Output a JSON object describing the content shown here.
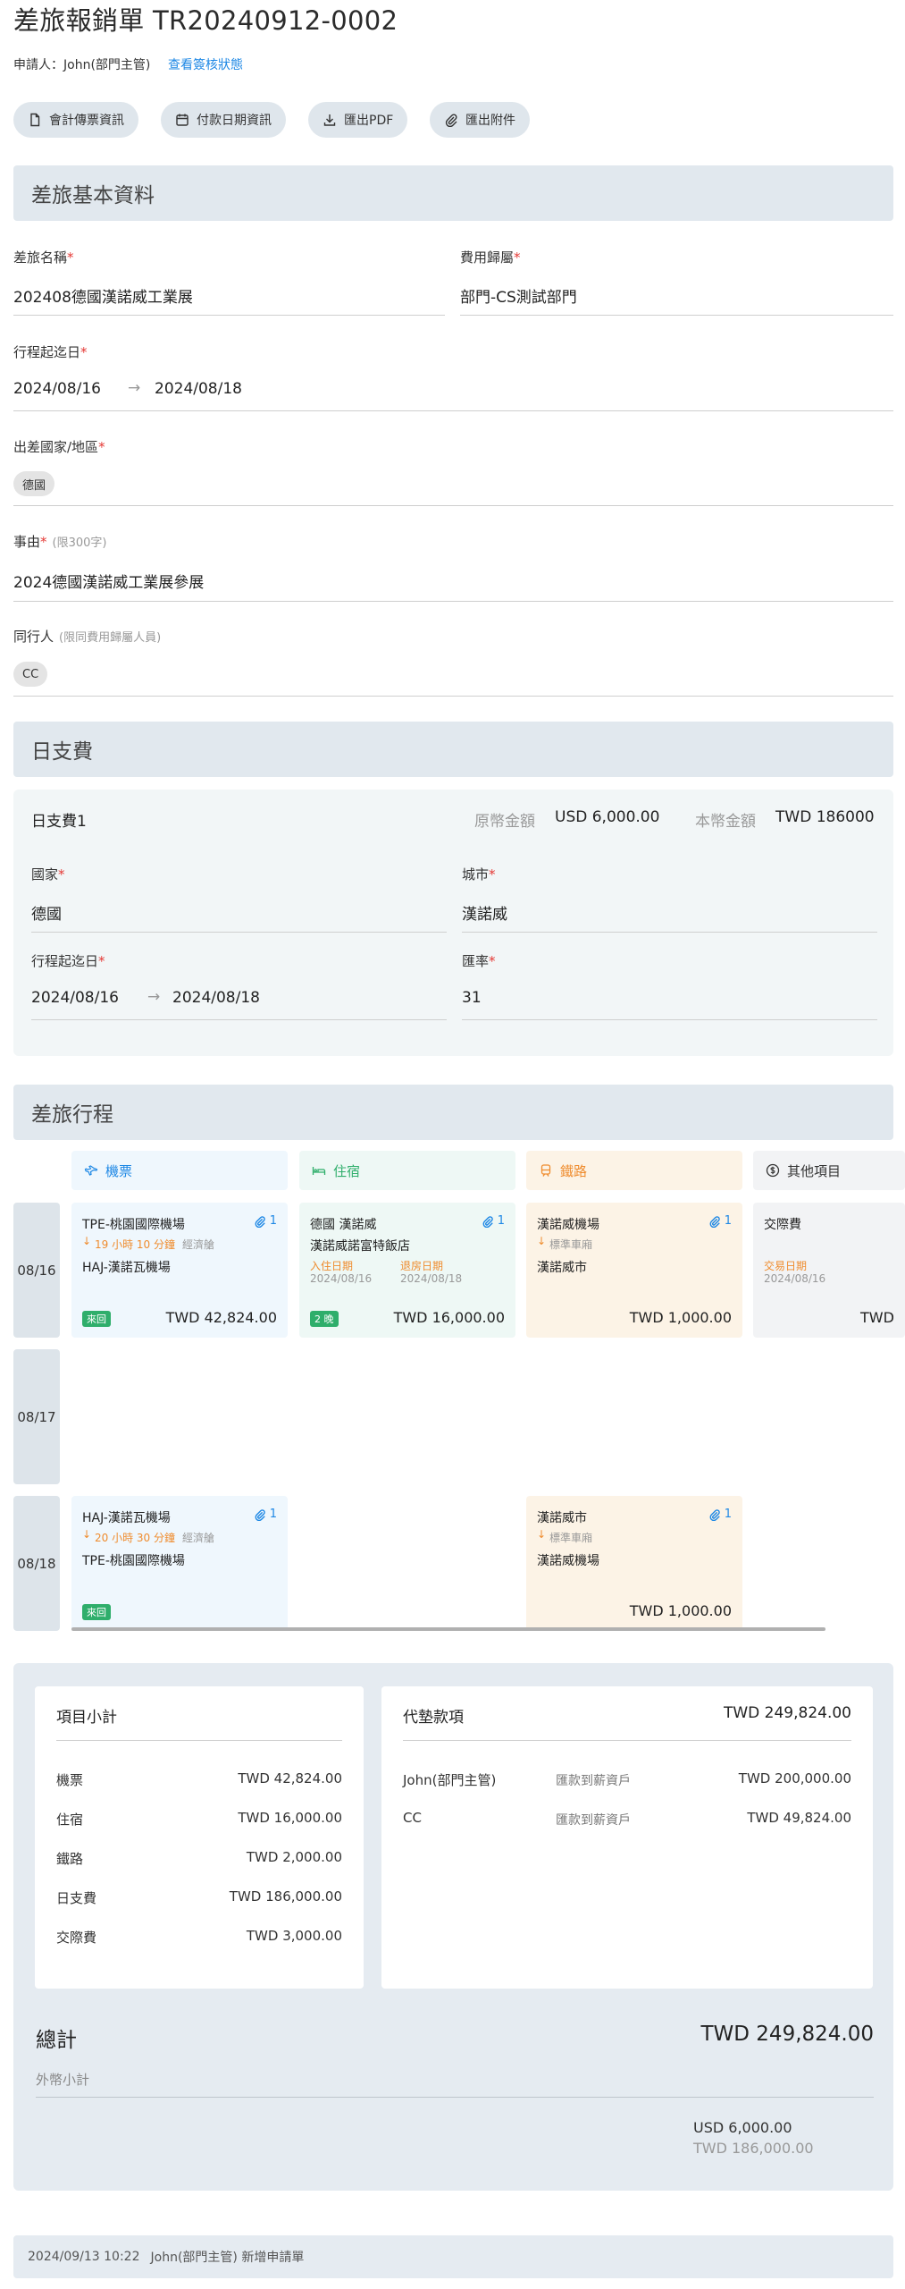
{
  "header": {
    "title": "差旅報銷單 TR20240912-0002",
    "applicant": "申請人：John(部門主管)",
    "status_link": "查看簽核狀態"
  },
  "toolbar": {
    "accounting": "會計傳票資訊",
    "payment_date": "付款日期資訊",
    "export_pdf": "匯出PDF",
    "export_attach": "匯出附件"
  },
  "basic": {
    "section_title": "差旅基本資料",
    "trip_name_label": "差旅名稱",
    "trip_name": "202408德國漢諾威工業展",
    "cost_owner_label": "費用歸屬",
    "cost_owner": "部門-CS測試部門",
    "dates_label": "行程起迄日",
    "start_date": "2024/08/16",
    "end_date": "2024/08/18",
    "country_label": "出差國家/地區",
    "country_chip": "德國",
    "reason_label": "事由",
    "reason_hint": "(限300字)",
    "reason": "2024德國漢諾威工業展參展",
    "companion_label": "同行人",
    "companion_hint": "(限同費用歸屬人員)",
    "companion_chip": "CC"
  },
  "daily": {
    "section_title": "日支費",
    "card_title": "日支費1",
    "orig_label": "原幣金額",
    "orig_amount": "USD 6,000.00",
    "local_label": "本幣金額",
    "local_amount": "TWD 186000",
    "country_label": "國家",
    "country": "德國",
    "city_label": "城市",
    "city": "漢諾威",
    "dates_label": "行程起迄日",
    "start_date": "2024/08/16",
    "end_date": "2024/08/18",
    "rate_label": "匯率",
    "rate": "31"
  },
  "itinerary": {
    "section_title": "差旅行程",
    "columns": {
      "flight": "機票",
      "hotel": "住宿",
      "rail": "鐵路",
      "other": "其他項目"
    },
    "dates": [
      "08/16",
      "08/17",
      "08/18"
    ],
    "flight1": {
      "from": "TPE-桃園國際機場",
      "duration": "19 小時 10 分鐘",
      "via": "經濟艙",
      "to": "HAJ-漢諾瓦機場",
      "badge": "來回",
      "amount": "TWD 42,824.00",
      "attach": "1"
    },
    "hotel1": {
      "location": "德國 漢諾威",
      "name": "漢諾威諾富特飯店",
      "checkin_label": "入住日期",
      "checkin": "2024/08/16",
      "checkout_label": "退房日期",
      "checkout": "2024/08/18",
      "badge": "2 晚",
      "amount": "TWD 16,000.00",
      "attach": "1"
    },
    "rail1": {
      "from": "漢諾威機場",
      "class": "標準車廂",
      "to": "漢諾威市",
      "amount": "TWD 1,000.00",
      "attach": "1"
    },
    "other1": {
      "name": "交際費",
      "date_label": "交易日期",
      "date": "2024/08/16",
      "amount_partial": "TWD"
    },
    "flight2": {
      "from": "HAJ-漢諾瓦機場",
      "duration": "20 小時 30 分鐘",
      "via": "經濟艙",
      "to": "TPE-桃園國際機場",
      "badge": "來回",
      "attach": "1"
    },
    "rail2": {
      "from": "漢諾威市",
      "class": "標準車廂",
      "to": "漢諾威機場",
      "amount": "TWD 1,000.00",
      "attach": "1"
    }
  },
  "summary": {
    "subtotal_title": "項目小計",
    "subtotals": [
      {
        "label": "機票",
        "value": "TWD 42,824.00"
      },
      {
        "label": "住宿",
        "value": "TWD 16,000.00"
      },
      {
        "label": "鐵路",
        "value": "TWD 2,000.00"
      },
      {
        "label": "日支費",
        "value": "TWD 186,000.00"
      },
      {
        "label": "交際費",
        "value": "TWD 3,000.00"
      }
    ],
    "advance_title": "代墊款項",
    "advance_total": "TWD 249,824.00",
    "advances": [
      {
        "name": "John(部門主管)",
        "method": "匯款到薪資戶",
        "value": "TWD 200,000.00"
      },
      {
        "name": "CC",
        "method": "匯款到薪資戶",
        "value": "TWD 49,824.00"
      }
    ],
    "total_label": "總計",
    "total_value": "TWD 249,824.00",
    "foreign_label": "外幣小計",
    "foreign_usd": "USD 6,000.00",
    "foreign_twd": "TWD 186,000.00"
  },
  "log": {
    "time": "2024/09/13 10:22",
    "text": "John(部門主管) 新增申請單"
  },
  "colors": {
    "accent": "#1e88e5",
    "section_bg": "#e1e8ee",
    "flight_bg": "#eff7fd",
    "hotel_bg": "#eef8f5",
    "rail_bg": "#fcf3e6",
    "other_bg": "#f2f3f5",
    "badge_green": "#2fae6b",
    "orange": "#ef8c2e",
    "required": "#e53935"
  }
}
